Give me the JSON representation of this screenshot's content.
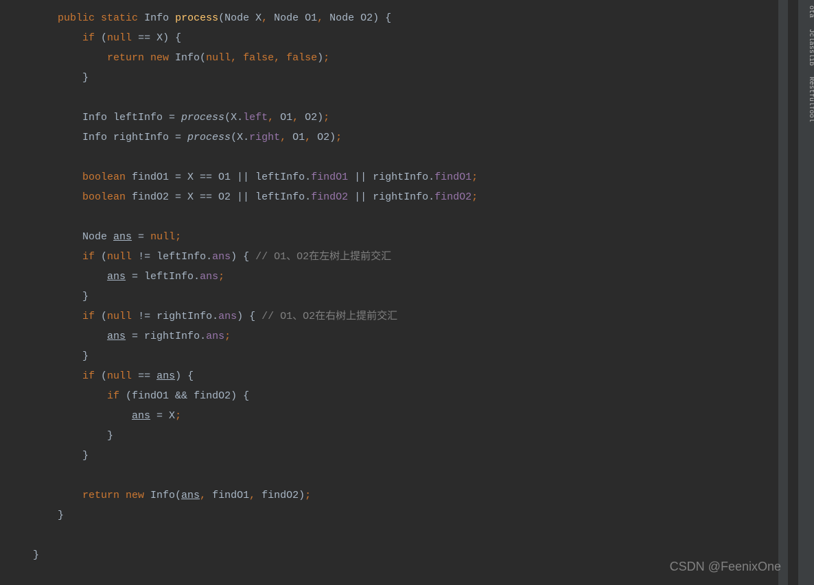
{
  "sidebar": {
    "items": [
      {
        "label": "ota"
      },
      {
        "label": "Jclasslib"
      },
      {
        "label": "RestfulTool"
      }
    ]
  },
  "watermark": "CSDN @FeenixOne",
  "code": {
    "tokens": [
      [
        {
          "t": "    ",
          "c": ""
        },
        {
          "t": "public",
          "c": "kw"
        },
        {
          "t": " ",
          "c": ""
        },
        {
          "t": "static",
          "c": "kw"
        },
        {
          "t": " Info ",
          "c": "type"
        },
        {
          "t": "process",
          "c": "method-decl"
        },
        {
          "t": "(Node X",
          "c": "type"
        },
        {
          "t": ",",
          "c": "kw"
        },
        {
          "t": " Node O1",
          "c": "type"
        },
        {
          "t": ",",
          "c": "kw"
        },
        {
          "t": " Node O2) {",
          "c": "type"
        }
      ],
      [
        {
          "t": "        ",
          "c": ""
        },
        {
          "t": "if",
          "c": "kw"
        },
        {
          "t": " (",
          "c": ""
        },
        {
          "t": "null",
          "c": "kw"
        },
        {
          "t": " == X) {",
          "c": ""
        }
      ],
      [
        {
          "t": "            ",
          "c": ""
        },
        {
          "t": "return new",
          "c": "kw"
        },
        {
          "t": " Info(",
          "c": ""
        },
        {
          "t": "null",
          "c": "kw"
        },
        {
          "t": ", ",
          "c": "kw"
        },
        {
          "t": "false",
          "c": "kw"
        },
        {
          "t": ", ",
          "c": "kw"
        },
        {
          "t": "false",
          "c": "kw"
        },
        {
          "t": ")",
          "c": ""
        },
        {
          "t": ";",
          "c": "kw"
        }
      ],
      [
        {
          "t": "        }",
          "c": ""
        }
      ],
      [
        {
          "t": "",
          "c": ""
        }
      ],
      [
        {
          "t": "        Info leftInfo = ",
          "c": ""
        },
        {
          "t": "process",
          "c": "italic-call"
        },
        {
          "t": "(X.",
          "c": ""
        },
        {
          "t": "left",
          "c": "field"
        },
        {
          "t": ",",
          "c": "kw"
        },
        {
          "t": " O1",
          "c": ""
        },
        {
          "t": ",",
          "c": "kw"
        },
        {
          "t": " O2)",
          "c": ""
        },
        {
          "t": ";",
          "c": "kw"
        }
      ],
      [
        {
          "t": "        Info rightInfo = ",
          "c": ""
        },
        {
          "t": "process",
          "c": "italic-call"
        },
        {
          "t": "(X.",
          "c": ""
        },
        {
          "t": "right",
          "c": "field"
        },
        {
          "t": ",",
          "c": "kw"
        },
        {
          "t": " O1",
          "c": ""
        },
        {
          "t": ",",
          "c": "kw"
        },
        {
          "t": " O2)",
          "c": ""
        },
        {
          "t": ";",
          "c": "kw"
        }
      ],
      [
        {
          "t": "",
          "c": ""
        }
      ],
      [
        {
          "t": "        ",
          "c": ""
        },
        {
          "t": "boolean",
          "c": "kw"
        },
        {
          "t": " findO1 = X == O1 || leftInfo.",
          "c": ""
        },
        {
          "t": "findO1",
          "c": "field"
        },
        {
          "t": " || rightInfo.",
          "c": ""
        },
        {
          "t": "findO1",
          "c": "field"
        },
        {
          "t": ";",
          "c": "kw"
        }
      ],
      [
        {
          "t": "        ",
          "c": ""
        },
        {
          "t": "boolean",
          "c": "kw"
        },
        {
          "t": " findO2 = X == O2 || leftInfo.",
          "c": ""
        },
        {
          "t": "findO2",
          "c": "field"
        },
        {
          "t": " || rightInfo.",
          "c": ""
        },
        {
          "t": "findO2",
          "c": "field"
        },
        {
          "t": ";",
          "c": "kw"
        }
      ],
      [
        {
          "t": "",
          "c": ""
        }
      ],
      [
        {
          "t": "        Node ",
          "c": ""
        },
        {
          "t": "ans",
          "c": "underline"
        },
        {
          "t": " = ",
          "c": ""
        },
        {
          "t": "null",
          "c": "kw"
        },
        {
          "t": ";",
          "c": "kw"
        }
      ],
      [
        {
          "t": "        ",
          "c": ""
        },
        {
          "t": "if",
          "c": "kw"
        },
        {
          "t": " (",
          "c": ""
        },
        {
          "t": "null",
          "c": "kw"
        },
        {
          "t": " != leftInfo.",
          "c": ""
        },
        {
          "t": "ans",
          "c": "field"
        },
        {
          "t": ") { ",
          "c": ""
        },
        {
          "t": "// O1、O2在左树上提前交汇",
          "c": "comment"
        }
      ],
      [
        {
          "t": "            ",
          "c": ""
        },
        {
          "t": "ans",
          "c": "underline"
        },
        {
          "t": " = leftInfo.",
          "c": ""
        },
        {
          "t": "ans",
          "c": "field"
        },
        {
          "t": ";",
          "c": "kw"
        }
      ],
      [
        {
          "t": "        }",
          "c": ""
        }
      ],
      [
        {
          "t": "        ",
          "c": ""
        },
        {
          "t": "if",
          "c": "kw"
        },
        {
          "t": " (",
          "c": ""
        },
        {
          "t": "null",
          "c": "kw"
        },
        {
          "t": " != rightInfo.",
          "c": ""
        },
        {
          "t": "ans",
          "c": "field"
        },
        {
          "t": ") { ",
          "c": ""
        },
        {
          "t": "// O1、O2在右树上提前交汇",
          "c": "comment"
        }
      ],
      [
        {
          "t": "            ",
          "c": ""
        },
        {
          "t": "ans",
          "c": "underline"
        },
        {
          "t": " = rightInfo.",
          "c": ""
        },
        {
          "t": "ans",
          "c": "field"
        },
        {
          "t": ";",
          "c": "kw"
        }
      ],
      [
        {
          "t": "        }",
          "c": ""
        }
      ],
      [
        {
          "t": "        ",
          "c": ""
        },
        {
          "t": "if",
          "c": "kw"
        },
        {
          "t": " (",
          "c": ""
        },
        {
          "t": "null",
          "c": "kw"
        },
        {
          "t": " == ",
          "c": ""
        },
        {
          "t": "ans",
          "c": "underline"
        },
        {
          "t": ") {",
          "c": ""
        }
      ],
      [
        {
          "t": "            ",
          "c": ""
        },
        {
          "t": "if",
          "c": "kw"
        },
        {
          "t": " (findO1 && findO2) {",
          "c": ""
        }
      ],
      [
        {
          "t": "                ",
          "c": ""
        },
        {
          "t": "ans",
          "c": "underline"
        },
        {
          "t": " = X",
          "c": ""
        },
        {
          "t": ";",
          "c": "kw"
        }
      ],
      [
        {
          "t": "            }",
          "c": ""
        }
      ],
      [
        {
          "t": "        }",
          "c": ""
        }
      ],
      [
        {
          "t": "",
          "c": ""
        }
      ],
      [
        {
          "t": "        ",
          "c": ""
        },
        {
          "t": "return new",
          "c": "kw"
        },
        {
          "t": " Info(",
          "c": ""
        },
        {
          "t": "ans",
          "c": "underline"
        },
        {
          "t": ",",
          "c": "kw"
        },
        {
          "t": " findO1",
          "c": ""
        },
        {
          "t": ",",
          "c": "kw"
        },
        {
          "t": " findO2)",
          "c": ""
        },
        {
          "t": ";",
          "c": "kw"
        }
      ],
      [
        {
          "t": "    }",
          "c": ""
        }
      ],
      [
        {
          "t": "",
          "c": ""
        }
      ],
      [
        {
          "t": "}",
          "c": ""
        }
      ]
    ]
  }
}
